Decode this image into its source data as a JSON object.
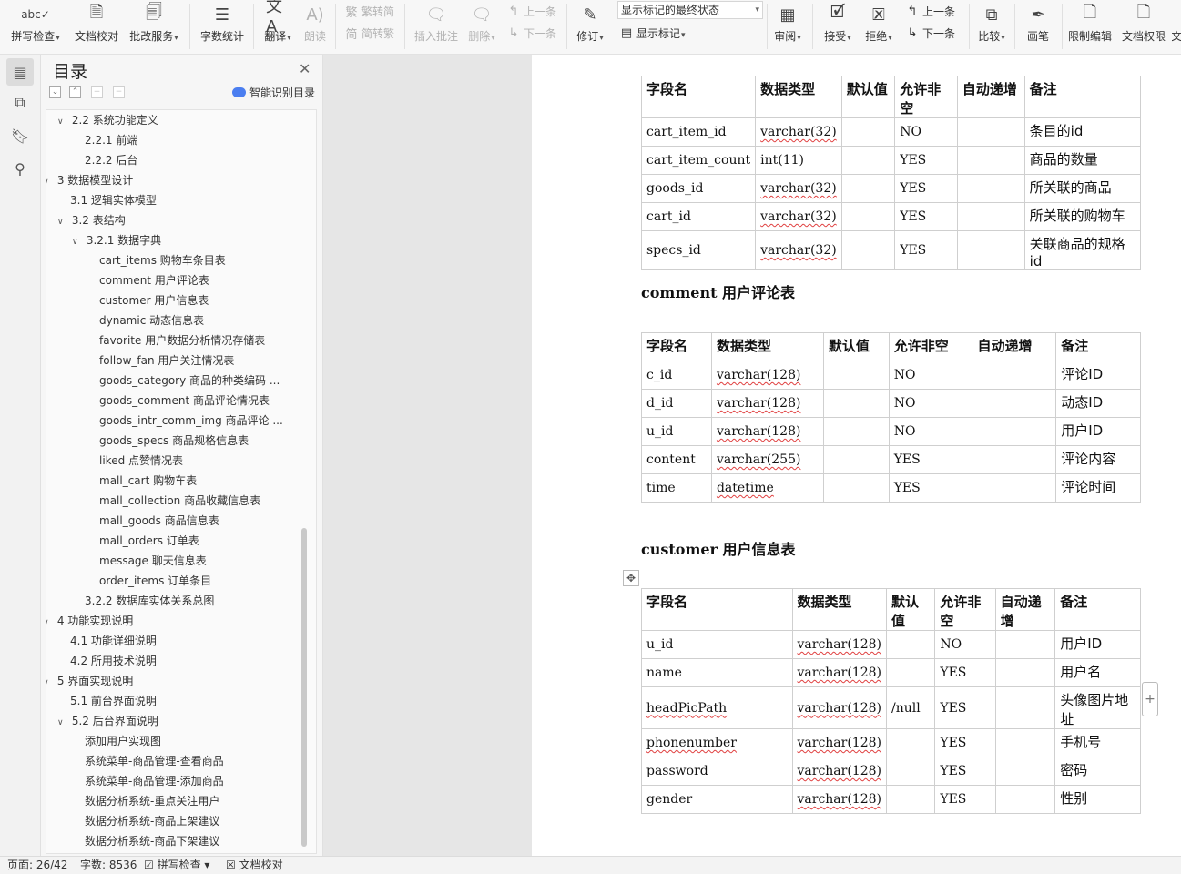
{
  "ribbon": {
    "spell_check": "拼写检查",
    "doc_proof": "文档校对",
    "batch_service": "批改服务",
    "word_count": "字数统计",
    "translate": "翻译",
    "read_aloud": "朗读",
    "to_traditional": "繁转简",
    "to_simplified": "简转繁",
    "insert_comment": "插入批注",
    "delete": "删除",
    "prev_comment": "上一条",
    "next_comment": "下一条",
    "track_changes": "修订",
    "markup_state": "显示标记的最终状态",
    "show_markup": "显示标记",
    "review": "审阅",
    "accept": "接受",
    "reject": "拒绝",
    "prev_change": "上一条",
    "next_change": "下一条",
    "compare": "比较",
    "pen": "画笔",
    "restrict_edit": "限制编辑",
    "doc_permission": "文档权限",
    "more": "文"
  },
  "toc": {
    "title": "目录",
    "smart_label": "智能识别目录",
    "items": [
      {
        "text": "2.2  系统功能定义",
        "level": 2,
        "toggle": "open"
      },
      {
        "text": "2.2.1  前端",
        "level": 3,
        "toggle": ""
      },
      {
        "text": "2.2.2  后台",
        "level": 3,
        "toggle": ""
      },
      {
        "text": "3  数据模型设计",
        "level": 1,
        "toggle": "open"
      },
      {
        "text": "3.1  逻辑实体模型",
        "level": 2,
        "toggle": ""
      },
      {
        "text": "3.2  表结构",
        "level": 2,
        "toggle": "open"
      },
      {
        "text": "3.2.1 数据字典",
        "level": 3,
        "toggle": "open"
      },
      {
        "text": "cart_items 购物车条目表",
        "level": 4,
        "toggle": ""
      },
      {
        "text": "comment 用户评论表",
        "level": 4,
        "toggle": ""
      },
      {
        "text": "customer 用户信息表",
        "level": 4,
        "toggle": ""
      },
      {
        "text": "dynamic 动态信息表",
        "level": 4,
        "toggle": ""
      },
      {
        "text": "favorite 用户数据分析情况存储表",
        "level": 4,
        "toggle": ""
      },
      {
        "text": "follow_fan 用户关注情况表",
        "level": 4,
        "toggle": ""
      },
      {
        "text": "goods_category 商品的种类编码 ...",
        "level": 4,
        "toggle": ""
      },
      {
        "text": "goods_comment 商品评论情况表",
        "level": 4,
        "toggle": ""
      },
      {
        "text": "goods_intr_comm_img 商品评论 ...",
        "level": 4,
        "toggle": ""
      },
      {
        "text": "goods_specs 商品规格信息表",
        "level": 4,
        "toggle": ""
      },
      {
        "text": "liked 点赞情况表",
        "level": 4,
        "toggle": ""
      },
      {
        "text": "mall_cart 购物车表",
        "level": 4,
        "toggle": ""
      },
      {
        "text": "mall_collection 商品收藏信息表",
        "level": 4,
        "toggle": ""
      },
      {
        "text": "mall_goods 商品信息表",
        "level": 4,
        "toggle": ""
      },
      {
        "text": "mall_orders 订单表",
        "level": 4,
        "toggle": ""
      },
      {
        "text": "message 聊天信息表",
        "level": 4,
        "toggle": ""
      },
      {
        "text": "order_items 订单条目",
        "level": 4,
        "toggle": ""
      },
      {
        "text": "3.2.2 数据库实体关系总图",
        "level": 3,
        "toggle": ""
      },
      {
        "text": "4  功能实现说明",
        "level": 1,
        "toggle": "open"
      },
      {
        "text": "4.1  功能详细说明",
        "level": 2,
        "toggle": ""
      },
      {
        "text": "4.2  所用技术说明",
        "level": 2,
        "toggle": ""
      },
      {
        "text": "5  界面实现说明",
        "level": 1,
        "toggle": "open"
      },
      {
        "text": "5.1 前台界面说明",
        "level": 2,
        "toggle": ""
      },
      {
        "text": "5.2 后台界面说明",
        "level": 2,
        "toggle": "open"
      },
      {
        "text": "添加用户实现图",
        "level": 3,
        "toggle": ""
      },
      {
        "text": "系统菜单-商品管理-查看商品",
        "level": 3,
        "toggle": ""
      },
      {
        "text": "系统菜单-商品管理-添加商品",
        "level": 3,
        "toggle": ""
      },
      {
        "text": "数据分析系统-重点关注用户",
        "level": 3,
        "toggle": ""
      },
      {
        "text": "数据分析系统-商品上架建议",
        "level": 3,
        "toggle": ""
      },
      {
        "text": "数据分析系统-商品下架建议",
        "level": 3,
        "toggle": ""
      }
    ]
  },
  "document": {
    "headers": [
      "字段名",
      "数据类型",
      "默认值",
      "允许非空",
      "自动递增",
      "备注"
    ],
    "cart_items": {
      "rows": [
        [
          "cart_item_id",
          "varchar(32)",
          "",
          "NO",
          "",
          "条目的id"
        ],
        [
          "cart_item_count",
          "int(11)",
          "",
          "YES",
          "",
          "商品的数量"
        ],
        [
          "goods_id",
          "varchar(32)",
          "",
          "YES",
          "",
          "所关联的商品"
        ],
        [
          "cart_id",
          "varchar(32)",
          "",
          "YES",
          "",
          "所关联的购物车"
        ],
        [
          "specs_id",
          "varchar(32)",
          "",
          "YES",
          "",
          "关联商品的规格id"
        ]
      ]
    },
    "comment": {
      "title": "comment 用户评论表",
      "rows": [
        [
          "c_id",
          "varchar(128)",
          "",
          "NO",
          "",
          "评论ID"
        ],
        [
          "d_id",
          "varchar(128)",
          "",
          "NO",
          "",
          "动态ID"
        ],
        [
          "u_id",
          "varchar(128)",
          "",
          "NO",
          "",
          "用户ID"
        ],
        [
          "content",
          "varchar(255)",
          "",
          "YES",
          "",
          "评论内容"
        ],
        [
          "time",
          "datetime",
          "",
          "YES",
          "",
          "评论时间"
        ]
      ]
    },
    "customer": {
      "title": "customer 用户信息表",
      "rows": [
        [
          "u_id",
          "varchar(128)",
          "",
          "NO",
          "",
          "用户ID"
        ],
        [
          "name",
          "varchar(128)",
          "",
          "YES",
          "",
          "用户名"
        ],
        [
          "headPicPath",
          "varchar(128)",
          "/null",
          "YES",
          "",
          "头像图片地址"
        ],
        [
          "phonenumber",
          "varchar(128)",
          "",
          "YES",
          "",
          "手机号"
        ],
        [
          "password",
          "varchar(128)",
          "",
          "YES",
          "",
          "密码"
        ],
        [
          "gender",
          "varchar(128)",
          "",
          "YES",
          "",
          "性别"
        ]
      ]
    }
  },
  "status": {
    "page": "页面: 26/42",
    "word_count": "字数: 8536",
    "spell_check": "拼写检查",
    "doc_proof": "文档校对"
  }
}
